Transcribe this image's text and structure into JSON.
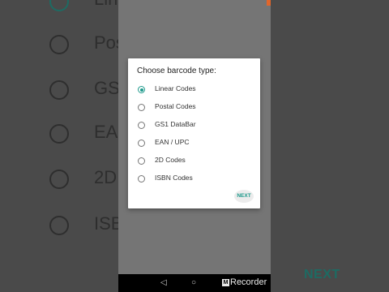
{
  "background": {
    "left_rows": [
      {
        "label": "Line",
        "checked": true
      },
      {
        "label": "Posta",
        "checked": false
      },
      {
        "label": "GS",
        "checked": false
      },
      {
        "label": "EAN",
        "checked": false
      },
      {
        "label": "2D",
        "checked": false
      },
      {
        "label": "ISBN",
        "checked": false
      }
    ],
    "next_label": "NEXT"
  },
  "dialog": {
    "title": "Choose barcode type:",
    "options": [
      {
        "label": "Linear Codes",
        "checked": true
      },
      {
        "label": "Postal Codes",
        "checked": false
      },
      {
        "label": "GS1 DataBar",
        "checked": false
      },
      {
        "label": "EAN / UPC",
        "checked": false
      },
      {
        "label": "2D Codes",
        "checked": false
      },
      {
        "label": "ISBN Codes",
        "checked": false
      }
    ],
    "next_label": "NEXT"
  },
  "nav": {
    "back_icon": "◁",
    "home_icon": "○",
    "recorder_label": "Recorder",
    "recorder_icon_letter": "M"
  },
  "colors": {
    "accent": "#1f9a8c",
    "status_accent": "#e0662c"
  }
}
